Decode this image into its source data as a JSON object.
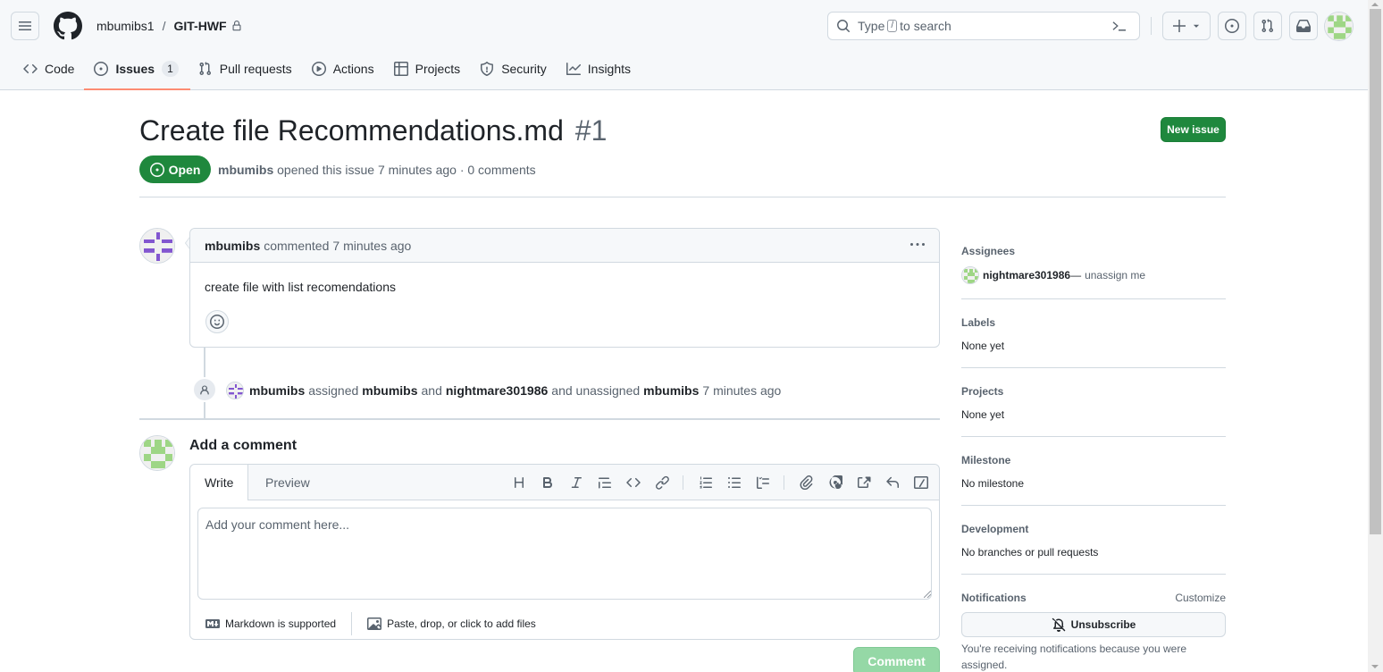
{
  "header": {
    "owner": "mbumibs1",
    "separator": "/",
    "repo": "GIT-HWF",
    "search_prefix": "Type",
    "search_key": "/",
    "search_suffix": "to search"
  },
  "nav_tabs": [
    {
      "label": "Code",
      "icon": "code-icon"
    },
    {
      "label": "Issues",
      "icon": "issue-opened-icon",
      "count": "1",
      "active": true
    },
    {
      "label": "Pull requests",
      "icon": "git-pull-request-icon"
    },
    {
      "label": "Actions",
      "icon": "play-icon"
    },
    {
      "label": "Projects",
      "icon": "table-icon"
    },
    {
      "label": "Security",
      "icon": "shield-icon"
    },
    {
      "label": "Insights",
      "icon": "graph-icon"
    }
  ],
  "issue": {
    "title": "Create file Recommendations.md",
    "number": "#1",
    "new_issue_label": "New issue",
    "state": "Open",
    "author": "mbumibs",
    "meta_text": "opened this issue 7 minutes ago · 0 comments"
  },
  "comment": {
    "author": "mbumibs",
    "action": "commented",
    "time": "7 minutes ago",
    "body": "create file with list recomendations"
  },
  "event": {
    "actor": "mbumibs",
    "verb1": "assigned",
    "target1": "mbumibs",
    "conj": "and",
    "target2": "nightmare301986",
    "verb2": "and unassigned",
    "target3": "mbumibs",
    "time": "7 minutes ago"
  },
  "composer": {
    "heading": "Add a comment",
    "tab_write": "Write",
    "tab_preview": "Preview",
    "placeholder": "Add your comment here...",
    "markdown_note": "Markdown is supported",
    "attach_note": "Paste, drop, or click to add files",
    "submit_label": "Comment"
  },
  "sidebar": {
    "assignees_label": "Assignees",
    "assignee_name": "nightmare301986",
    "assignee_dash": "—",
    "unassign_label": "unassign me",
    "labels_label": "Labels",
    "labels_value": "None yet",
    "projects_label": "Projects",
    "projects_value": "None yet",
    "milestone_label": "Milestone",
    "milestone_value": "No milestone",
    "development_label": "Development",
    "development_value": "No branches or pull requests",
    "notifications_label": "Notifications",
    "customize_label": "Customize",
    "unsubscribe_label": "Unsubscribe",
    "notification_note": "You're receiving notifications because you were assigned."
  },
  "colors": {
    "open_green": "#1f883d",
    "tab_underline": "#fd8c73",
    "disabled_green": "#95d8a6"
  }
}
